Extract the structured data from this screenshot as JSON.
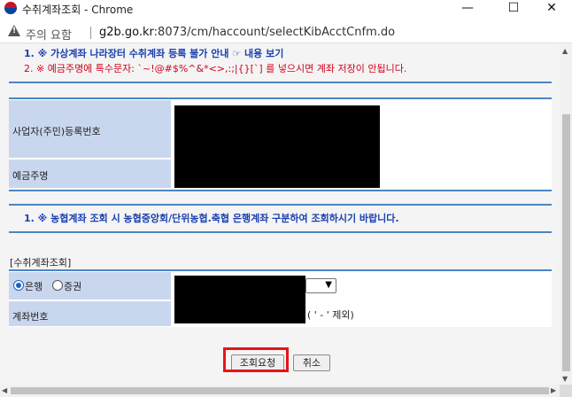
{
  "window": {
    "title": "수취계좌조회 - Chrome",
    "minimize": "—",
    "maximize": "☐",
    "close": "✕"
  },
  "address_bar": {
    "warning": "주의 요함",
    "url_host": "g2b.go.kr",
    "url_rest": ":8073/cm/haccount/selectKibAcctCnfm.do"
  },
  "notices": {
    "line1": "1. ※ 가상계좌 나라장터 수취계좌 등록 불가 안내 ☞ 내용 보기",
    "line2": "2. ※ 예금주명에 특수문자: `~!@#$%^&*<>,:;|{}[`] 를 넣으시면 계좌 저장이 안됩니다.",
    "line3": "1. ※ 농협계좌 조회 시 농협중앙회/단위농협.축협 은행계좌 구분하여 조회하시기 바랍니다."
  },
  "colors": {
    "notice_blue": "#1a3fae",
    "notice_red": "#d0021b",
    "label_bg": "#c9d7ee",
    "rule": "#4a86c5",
    "highlight": "#e8121b"
  },
  "info_table": {
    "biz_no_label": "사업자(주민)등록번호",
    "holder_label": "예금주명"
  },
  "account_section": {
    "title": "[수취계좌조회]",
    "radio_bank": "은행",
    "radio_securities": "증권",
    "selected": "은행",
    "account_label": "계좌번호",
    "account_hint": "( ' - ' 제외)"
  },
  "buttons": {
    "search": "조회요청",
    "cancel": "취소"
  }
}
